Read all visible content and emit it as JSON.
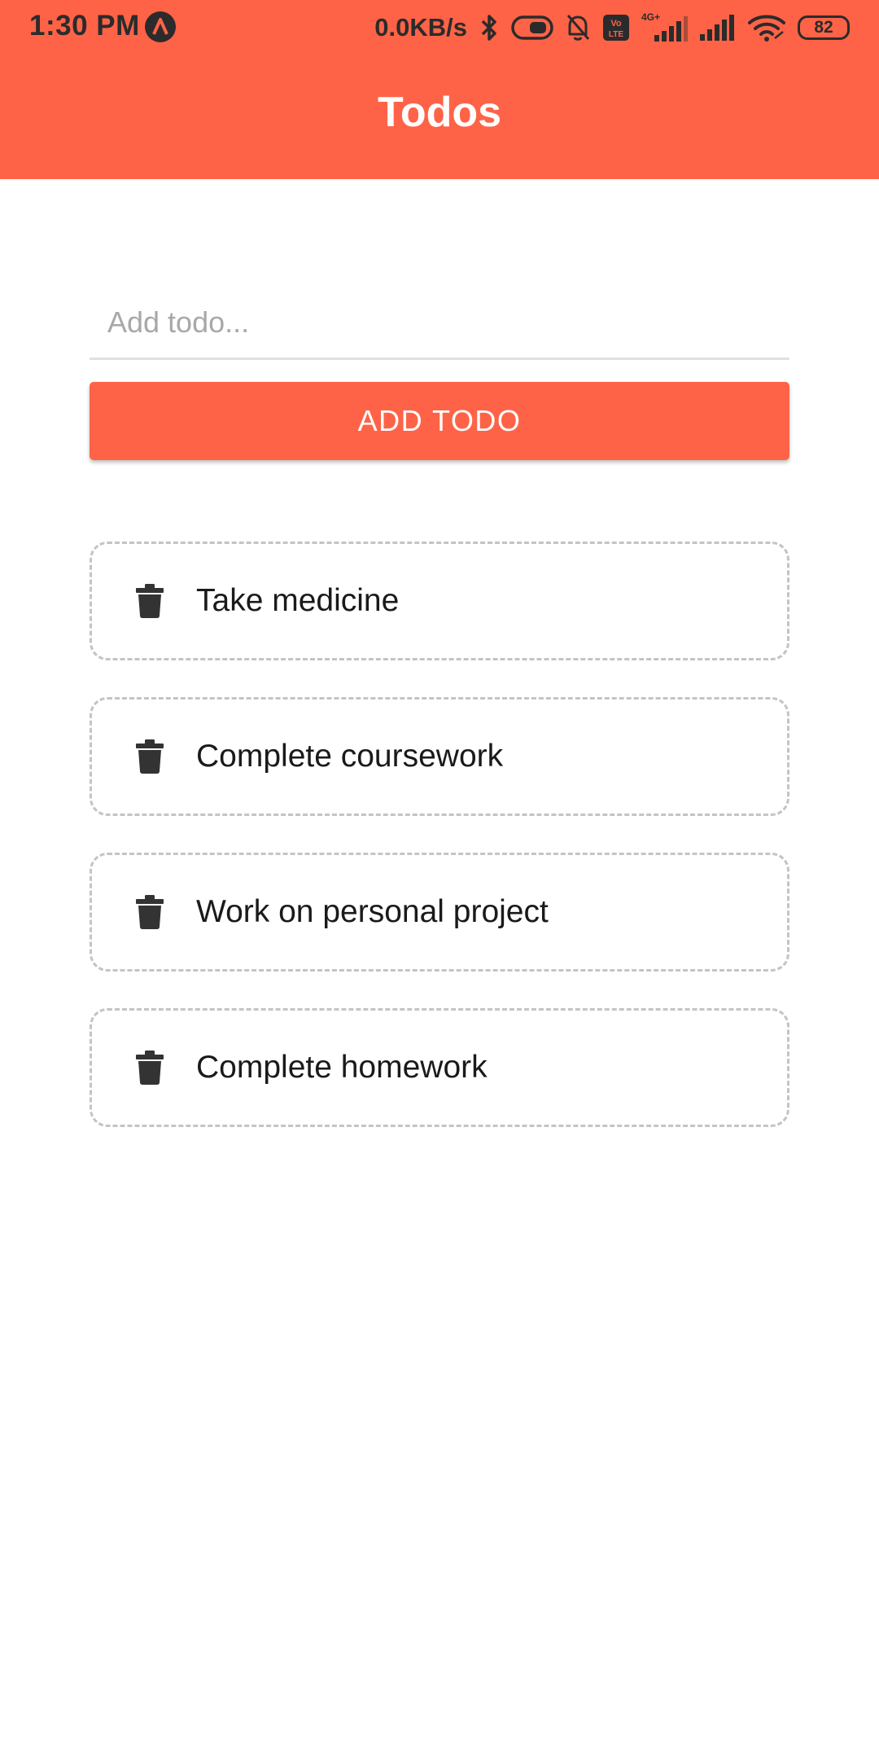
{
  "status_bar": {
    "time": "1:30 PM",
    "network_speed": "0.0KB/s",
    "battery_level": "82",
    "icons": [
      "app-notification-icon",
      "bluetooth-icon",
      "key-toggle-icon",
      "bell-off-icon",
      "volte-icon",
      "4g-signal-icon",
      "signal-icon",
      "wifi-icon",
      "battery-icon"
    ]
  },
  "header": {
    "title": "Todos"
  },
  "form": {
    "input_value": "",
    "input_placeholder": "Add todo...",
    "add_button_label": "ADD TODO"
  },
  "todos": [
    {
      "text": "Take medicine",
      "icon": "trash-icon"
    },
    {
      "text": "Complete coursework",
      "icon": "trash-icon"
    },
    {
      "text": "Work on personal project",
      "icon": "trash-icon"
    },
    {
      "text": "Complete homework",
      "icon": "trash-icon"
    }
  ],
  "colors": {
    "accent": "#FF6347",
    "background": "#FFFFFF",
    "item_border": "#C4C4C4",
    "icon": "#333333"
  }
}
